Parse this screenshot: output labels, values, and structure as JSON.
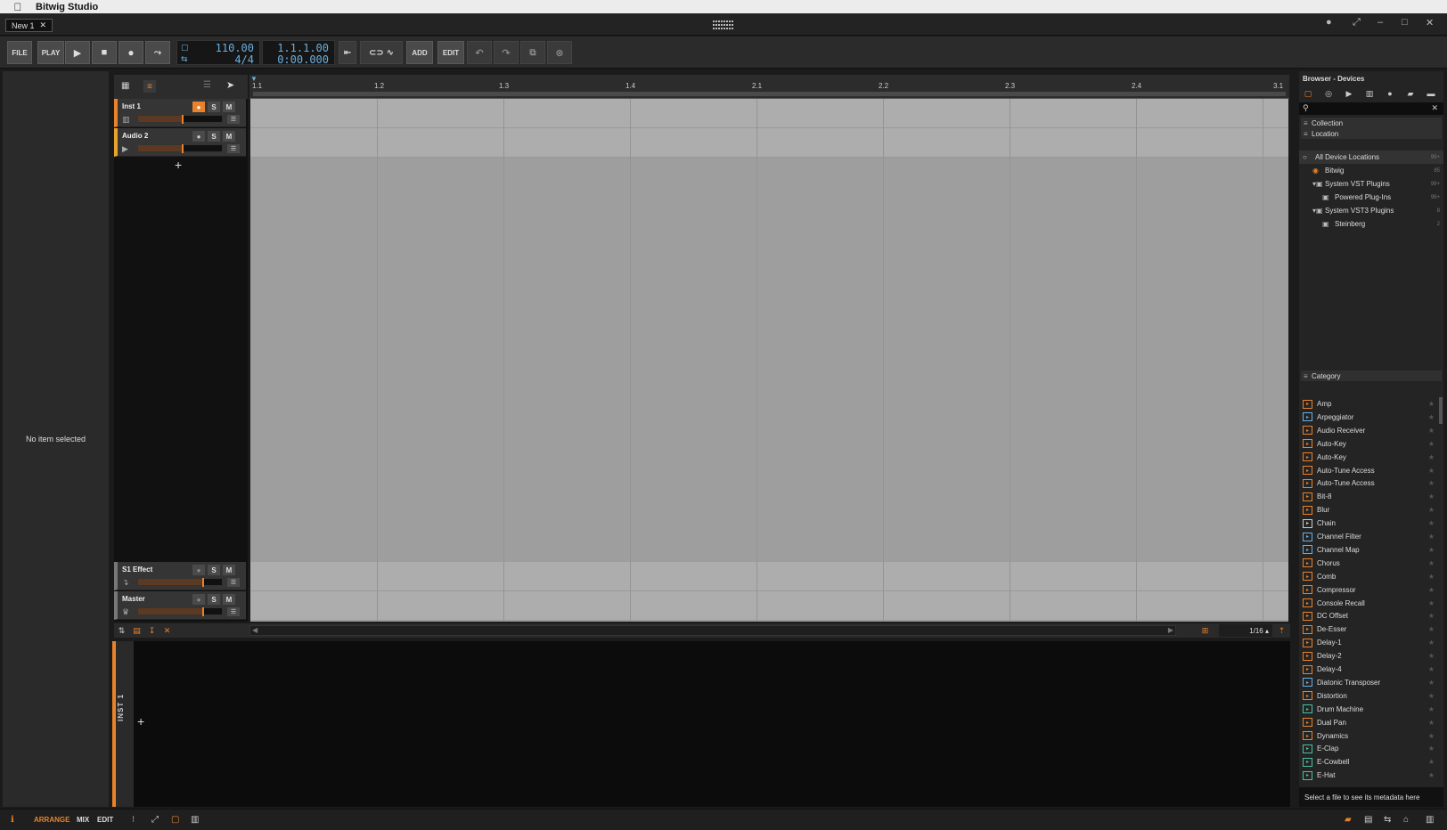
{
  "menubar": {
    "app_name": "Bitwig Studio"
  },
  "window": {
    "tab_label": "New 1",
    "tab_close": "✕"
  },
  "toolbar": {
    "file": "FILE",
    "play_label": "PLAY",
    "tempo": "110.00",
    "time_signature": "4/4",
    "position_bars": "1.1.1.00",
    "position_time": "0:00.000",
    "add": "ADD",
    "edit": "EDIT"
  },
  "inspector": {
    "message": "No item selected"
  },
  "ruler": {
    "ticks": [
      "1.1",
      "1.2",
      "1.3",
      "1.4",
      "2.1",
      "2.2",
      "2.3",
      "2.4",
      "3.1"
    ]
  },
  "tracks": [
    {
      "name": "Inst 1",
      "type": "instrument",
      "volume": 0.52,
      "armed": true,
      "color": "#e9822a"
    },
    {
      "name": "Audio 2",
      "type": "audio",
      "volume": 0.52,
      "armed": false,
      "color": "#e9a22a"
    }
  ],
  "bottom_tracks": [
    {
      "name": "S1 Effect",
      "volume": 0.77
    },
    {
      "name": "Master",
      "volume": 0.77
    }
  ],
  "track_buttons": {
    "solo": "S",
    "mute": "M"
  },
  "arranger_footer": {
    "grid": "1/16 ▴"
  },
  "detail": {
    "track_label": "INST 1"
  },
  "browser": {
    "title": "Browser - Devices",
    "sections": {
      "collection": "Collection",
      "location": "Location",
      "category": "Category"
    },
    "locations": [
      {
        "name": "All Device Locations",
        "count": "99+",
        "indent": 0,
        "icon": "circle"
      },
      {
        "name": "Bitwig",
        "count": "85",
        "indent": 1,
        "icon": "bitwig"
      },
      {
        "name": "System VST Plugins",
        "count": "99+",
        "indent": 1,
        "icon": "folder-open"
      },
      {
        "name": "Powered Plug-Ins",
        "count": "99+",
        "indent": 2,
        "icon": "folder"
      },
      {
        "name": "System VST3 Plugins",
        "count": "8",
        "indent": 1,
        "icon": "folder-open"
      },
      {
        "name": "Steinberg",
        "count": "2",
        "indent": 2,
        "icon": "folder"
      }
    ],
    "categories": [
      {
        "name": "Amp",
        "color": "#e9822a"
      },
      {
        "name": "Arpeggiator",
        "color": "#6ab0e0"
      },
      {
        "name": "Audio Receiver",
        "color": "#e9822a"
      },
      {
        "name": "Auto-Key",
        "color": "#e9822a"
      },
      {
        "name": "Auto-Key",
        "color": "#e9822a"
      },
      {
        "name": "Auto-Tune Access",
        "color": "#e9822a"
      },
      {
        "name": "Auto-Tune Access",
        "color": "#e9822a"
      },
      {
        "name": "Bit-8",
        "color": "#e9822a"
      },
      {
        "name": "Blur",
        "color": "#e9822a"
      },
      {
        "name": "Chain",
        "color": "#cccccc"
      },
      {
        "name": "Channel Filter",
        "color": "#6ab0e0"
      },
      {
        "name": "Channel Map",
        "color": "#6ab0e0"
      },
      {
        "name": "Chorus",
        "color": "#e9822a"
      },
      {
        "name": "Comb",
        "color": "#e9822a"
      },
      {
        "name": "Compressor",
        "color": "#e9822a"
      },
      {
        "name": "Console Recall",
        "color": "#e9822a"
      },
      {
        "name": "DC Offset",
        "color": "#e9822a"
      },
      {
        "name": "De-Esser",
        "color": "#e9822a"
      },
      {
        "name": "Delay-1",
        "color": "#e9822a"
      },
      {
        "name": "Delay-2",
        "color": "#e9822a"
      },
      {
        "name": "Delay-4",
        "color": "#e9822a"
      },
      {
        "name": "Diatonic Transposer",
        "color": "#6ab0e0"
      },
      {
        "name": "Distortion",
        "color": "#e9822a"
      },
      {
        "name": "Drum Machine",
        "color": "#4ac0a0"
      },
      {
        "name": "Dual Pan",
        "color": "#e9822a"
      },
      {
        "name": "Dynamics",
        "color": "#e9822a"
      },
      {
        "name": "E-Clap",
        "color": "#4ac0a0"
      },
      {
        "name": "E-Cowbell",
        "color": "#4ac0a0"
      },
      {
        "name": "E-Hat",
        "color": "#4ac0a0"
      }
    ],
    "footer": "Select a file to see its metadata here"
  },
  "statusbar": {
    "arrange": "ARRANGE",
    "mix": "MIX",
    "edit": "EDIT"
  }
}
